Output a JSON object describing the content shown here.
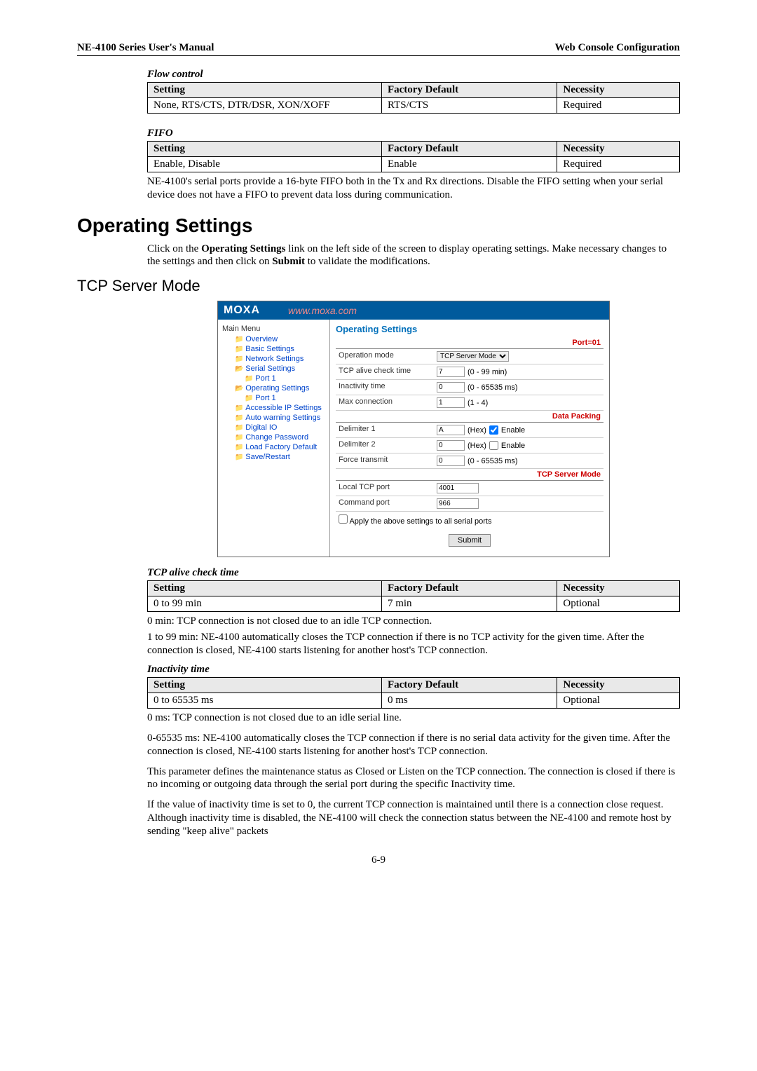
{
  "header_left": "NE-4100 Series User's Manual",
  "header_right": "Web Console Configuration",
  "flowcontrol": {
    "title": "Flow control",
    "headers": {
      "s": "Setting",
      "f": "Factory Default",
      "n": "Necessity"
    },
    "row": {
      "s": "None, RTS/CTS, DTR/DSR, XON/XOFF",
      "f": "RTS/CTS",
      "n": "Required"
    }
  },
  "fifo": {
    "title": "FIFO",
    "headers": {
      "s": "Setting",
      "f": "Factory Default",
      "n": "Necessity"
    },
    "row": {
      "s": "Enable, Disable",
      "f": "Enable",
      "n": "Required"
    },
    "desc": "NE-4100's serial ports provide a 16-byte FIFO both in the Tx and Rx directions. Disable the FIFO setting when your serial device does not have a FIFO to prevent data loss during communication."
  },
  "op_heading": "Operating Settings",
  "op_intro1": "Click on the ",
  "op_intro_b1": "Operating Settings",
  "op_intro2": " link on the left side of the screen to display operating settings. Make necessary changes to the settings and then click on ",
  "op_intro_b2": "Submit",
  "op_intro3": " to validate the modifications.",
  "tcp_heading": "TCP Server Mode",
  "screenshot": {
    "brand": "MOXA",
    "url": "www.moxa.com",
    "nav": {
      "root": "Main Menu",
      "items": [
        {
          "cls": "i1 folder",
          "label": "Overview"
        },
        {
          "cls": "i1 folder",
          "label": "Basic Settings"
        },
        {
          "cls": "i1 folder",
          "label": "Network Settings"
        },
        {
          "cls": "i1 folder-o",
          "label": "Serial Settings"
        },
        {
          "cls": "i2 folder",
          "label": "Port 1"
        },
        {
          "cls": "i1 folder-o",
          "label": "Operating Settings"
        },
        {
          "cls": "i2 folder",
          "label": "Port 1"
        },
        {
          "cls": "i1 folder",
          "label": "Accessible IP Settings"
        },
        {
          "cls": "i1 folder",
          "label": "Auto warning Settings"
        },
        {
          "cls": "i1 folder",
          "label": "Digital IO"
        },
        {
          "cls": "i1 folder",
          "label": "Change Password"
        },
        {
          "cls": "i1 folder",
          "label": "Load Factory Default"
        },
        {
          "cls": "i1 folder",
          "label": "Save/Restart"
        }
      ]
    },
    "main": {
      "title": "Operating Settings",
      "port_hdr": "Port=01",
      "rows": [
        {
          "label": "Operation mode",
          "type": "select",
          "value": "TCP Server Mode"
        },
        {
          "label": "TCP alive check time",
          "type": "text",
          "value": "7",
          "suffix": "(0 - 99 min)"
        },
        {
          "label": "Inactivity time",
          "type": "text",
          "value": "0",
          "suffix": "(0 - 65535 ms)"
        },
        {
          "label": "Max connection",
          "type": "text",
          "value": "1",
          "suffix": "(1 - 4)"
        }
      ],
      "dp_hdr": "Data Packing",
      "dp_rows": [
        {
          "label": "Delimiter 1",
          "value": "A",
          "suffix": "(Hex)",
          "cb": true,
          "cb_label": "Enable"
        },
        {
          "label": "Delimiter 2",
          "value": "0",
          "suffix": "(Hex)",
          "cb": false,
          "cb_label": "Enable"
        },
        {
          "label": "Force transmit",
          "value": "0",
          "suffix": "(0 - 65535 ms)"
        }
      ],
      "tsm_hdr": "TCP Server Mode",
      "tsm_rows": [
        {
          "label": "Local TCP port",
          "value": "4001"
        },
        {
          "label": "Command port",
          "value": "966"
        }
      ],
      "apply": "Apply the above settings to all serial ports",
      "submit": "Submit"
    }
  },
  "tcp_alive": {
    "title": "TCP alive check time",
    "headers": {
      "s": "Setting",
      "f": "Factory Default",
      "n": "Necessity"
    },
    "row": {
      "s": "0 to 99 min",
      "f": "7 min",
      "n": "Optional"
    },
    "desc1": "0 min: TCP connection is not closed due to an idle TCP connection.",
    "desc2": "1 to 99 min: NE-4100 automatically closes the TCP connection if there is no TCP activity for the given time. After the connection is closed, NE-4100 starts listening for another host's TCP connection."
  },
  "inactivity": {
    "title": "Inactivity time",
    "headers": {
      "s": "Setting",
      "f": "Factory Default",
      "n": "Necessity"
    },
    "row": {
      "s": "0 to 65535 ms",
      "f": "0 ms",
      "n": "Optional"
    },
    "desc1": "0 ms: TCP connection is not closed due to an idle serial line.",
    "desc2": "0-65535 ms: NE-4100 automatically closes the TCP connection if there is no serial data activity for the given time. After the connection is closed, NE-4100 starts listening for another host's TCP connection.",
    "desc3": "This parameter defines the maintenance status as Closed or Listen on the TCP connection. The connection is closed if there is no incoming or outgoing data through the serial port during the specific Inactivity time.",
    "desc4": "If the value of inactivity time is set to 0, the current TCP connection is maintained until there is a connection close request. Although inactivity time is disabled, the NE-4100 will check the connection status between the NE-4100 and remote host by sending \"keep alive\" packets"
  },
  "page_number": "6-9"
}
